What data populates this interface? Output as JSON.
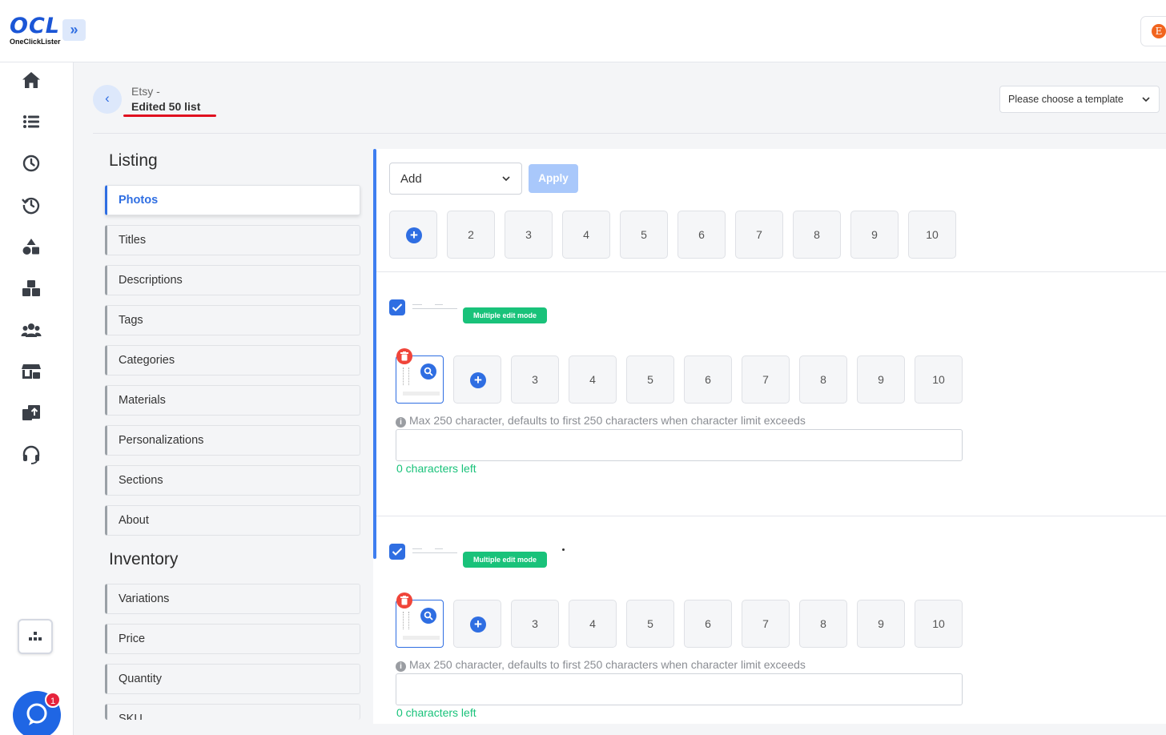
{
  "app": {
    "logo_text": "OCL",
    "logo_subtext": "OneClickLister",
    "expand_glyph": "»",
    "store_badge_letter": "E"
  },
  "sidebar": {
    "icons": [
      "home-icon",
      "list-icon",
      "clock-icon",
      "history-icon",
      "shapes-icon",
      "boxes-icon",
      "users-icon",
      "store-icon",
      "upload-icon",
      "headset-icon"
    ],
    "bottom_icon": "sitemap-icon",
    "chat_unread_count": "1"
  },
  "header": {
    "breadcrumb_parent": "Etsy -",
    "title": "Edited 50 list",
    "template_placeholder": "Please choose a template"
  },
  "sections": [
    {
      "heading": "Listing",
      "items": [
        "Photos",
        "Titles",
        "Descriptions",
        "Tags",
        "Categories",
        "Materials",
        "Personalizations",
        "Sections",
        "About"
      ]
    },
    {
      "heading": "Inventory",
      "items": [
        "Variations",
        "Price",
        "Quantity",
        "SKU"
      ]
    }
  ],
  "active_item": "Photos",
  "bulk": {
    "action_value": "Add",
    "apply_label": "Apply",
    "slots": [
      "2",
      "3",
      "4",
      "5",
      "6",
      "7",
      "8",
      "9",
      "10"
    ]
  },
  "listings": [
    {
      "checked": true,
      "mode_badge": "Multiple edit mode",
      "slots": [
        "3",
        "4",
        "5",
        "6",
        "7",
        "8",
        "9",
        "10"
      ],
      "hint": "Max 250 character, defaults to first 250 characters when character limit exceeds",
      "text_value": "",
      "chars_left": "0 characters left"
    },
    {
      "checked": true,
      "mode_badge": "Multiple edit mode",
      "slots": [
        "3",
        "4",
        "5",
        "6",
        "7",
        "8",
        "9",
        "10"
      ],
      "hint": "Max 250 character, defaults to first 250 characters when character limit exceeds",
      "text_value": "",
      "chars_left": "0 characters left"
    }
  ],
  "colors": {
    "primary": "#2f6ee2",
    "success": "#19c27a",
    "danger": "#f0453a",
    "underline": "#e0101f",
    "etsy": "#f1641e"
  }
}
